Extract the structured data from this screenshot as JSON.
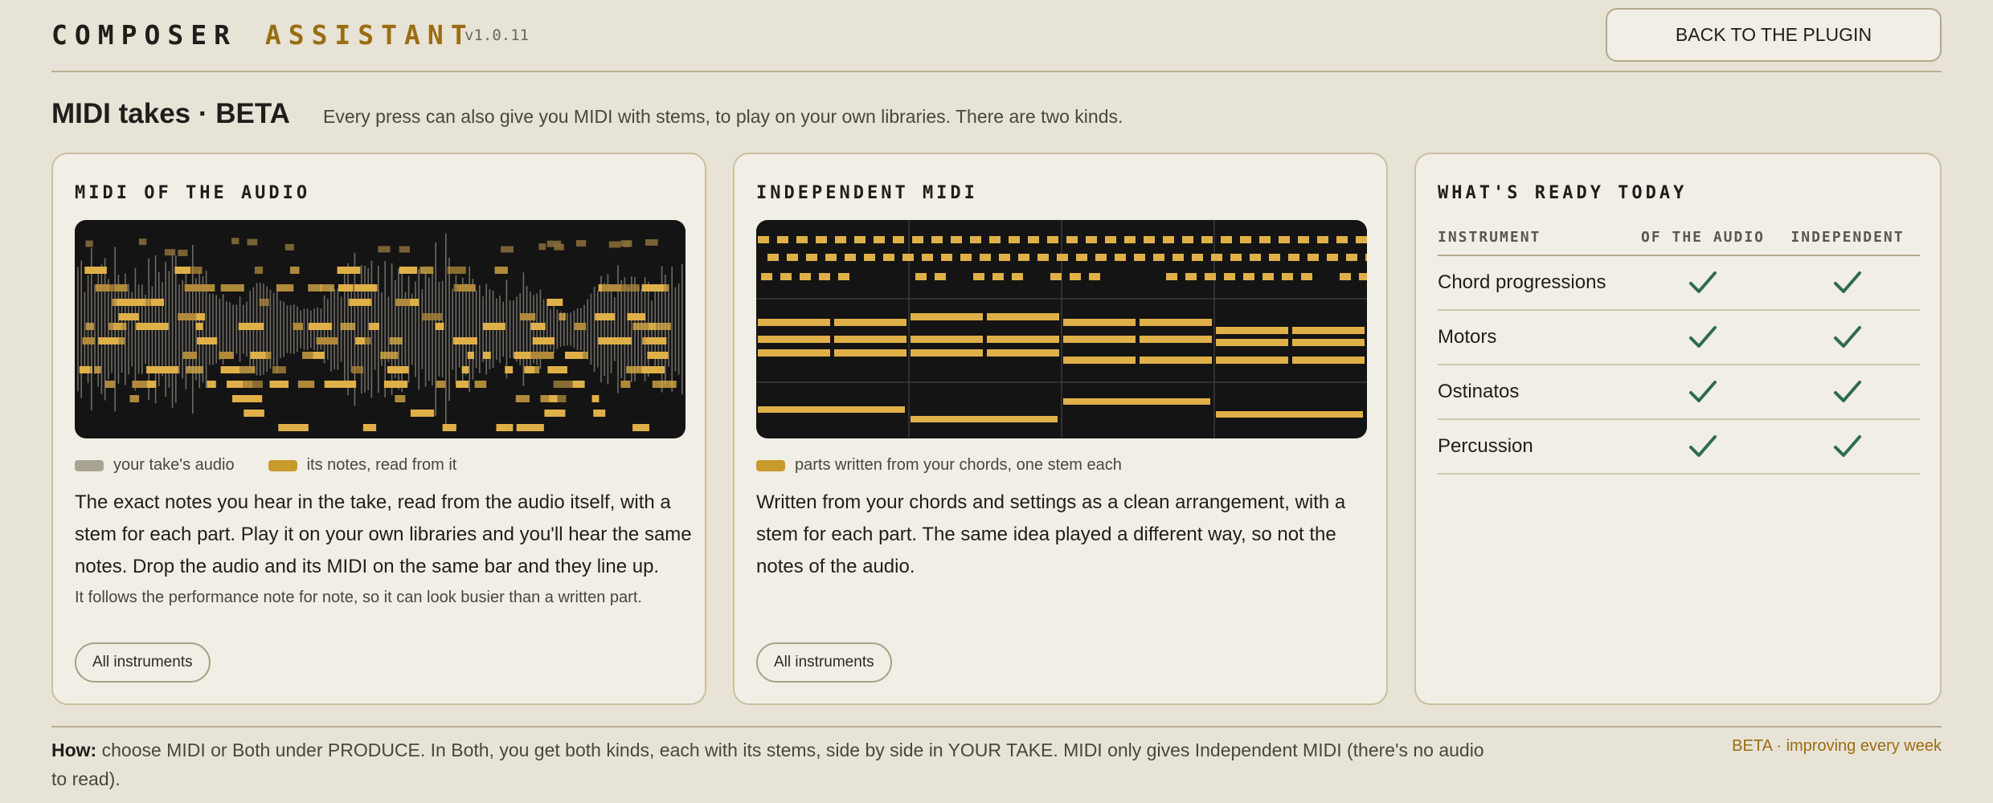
{
  "header": {
    "brand_word1": "COMPOSER",
    "brand_word2": "ASSISTANT",
    "version": "v1.0.11",
    "back_button": "BACK TO THE PLUGIN"
  },
  "intro": {
    "title": "MIDI takes · BETA",
    "subtitle": "Every press can also give you MIDI with stems, to play on your own libraries. There are two kinds."
  },
  "panels": [
    {
      "heading": "MIDI OF THE AUDIO",
      "legend": [
        "your take's audio",
        "its notes, read from it"
      ],
      "description": "The exact notes you hear in the take, read from the audio itself, with a stem for each part. Play it on your own libraries and you'll hear the same notes. Drop the audio and its MIDI on the same bar and they line up.",
      "note": "It follows the performance note for note, so it can look busier than a written part.",
      "button": "All instruments"
    },
    {
      "heading": "INDEPENDENT MIDI",
      "legend": [
        "parts written from your chords, one stem each"
      ],
      "description": "Written from your chords and settings as a clean arrangement, with a stem for each part. The same idea played a different way, so not the notes of the audio.",
      "button": "All instruments"
    }
  ],
  "ready": {
    "heading": "WHAT'S READY TODAY",
    "columns": [
      "INSTRUMENT",
      "OF THE AUDIO",
      "INDEPENDENT"
    ],
    "rows": [
      {
        "instrument": "Chord progressions",
        "of_audio": true,
        "independent": true
      },
      {
        "instrument": "Motors",
        "of_audio": true,
        "independent": true
      },
      {
        "instrument": "Ostinatos",
        "of_audio": true,
        "independent": true
      },
      {
        "instrument": "Percussion",
        "of_audio": true,
        "independent": true
      }
    ]
  },
  "footer": {
    "how_label": "How:",
    "how_text": "choose MIDI or Both under PRODUCE. In Both, you get both kinds, each with its stems, side by side in YOUR TAKE. MIDI only gives Independent MIDI (there's no audio to read).",
    "beta": "BETA · improving every week"
  },
  "colors": {
    "background": "#e8e3d7",
    "panel": "#f1eee6",
    "accent_gold": "#9a6d12",
    "note_gold": "#e0b048",
    "check_green": "#2e6b4f",
    "viz_bg": "#141414"
  }
}
